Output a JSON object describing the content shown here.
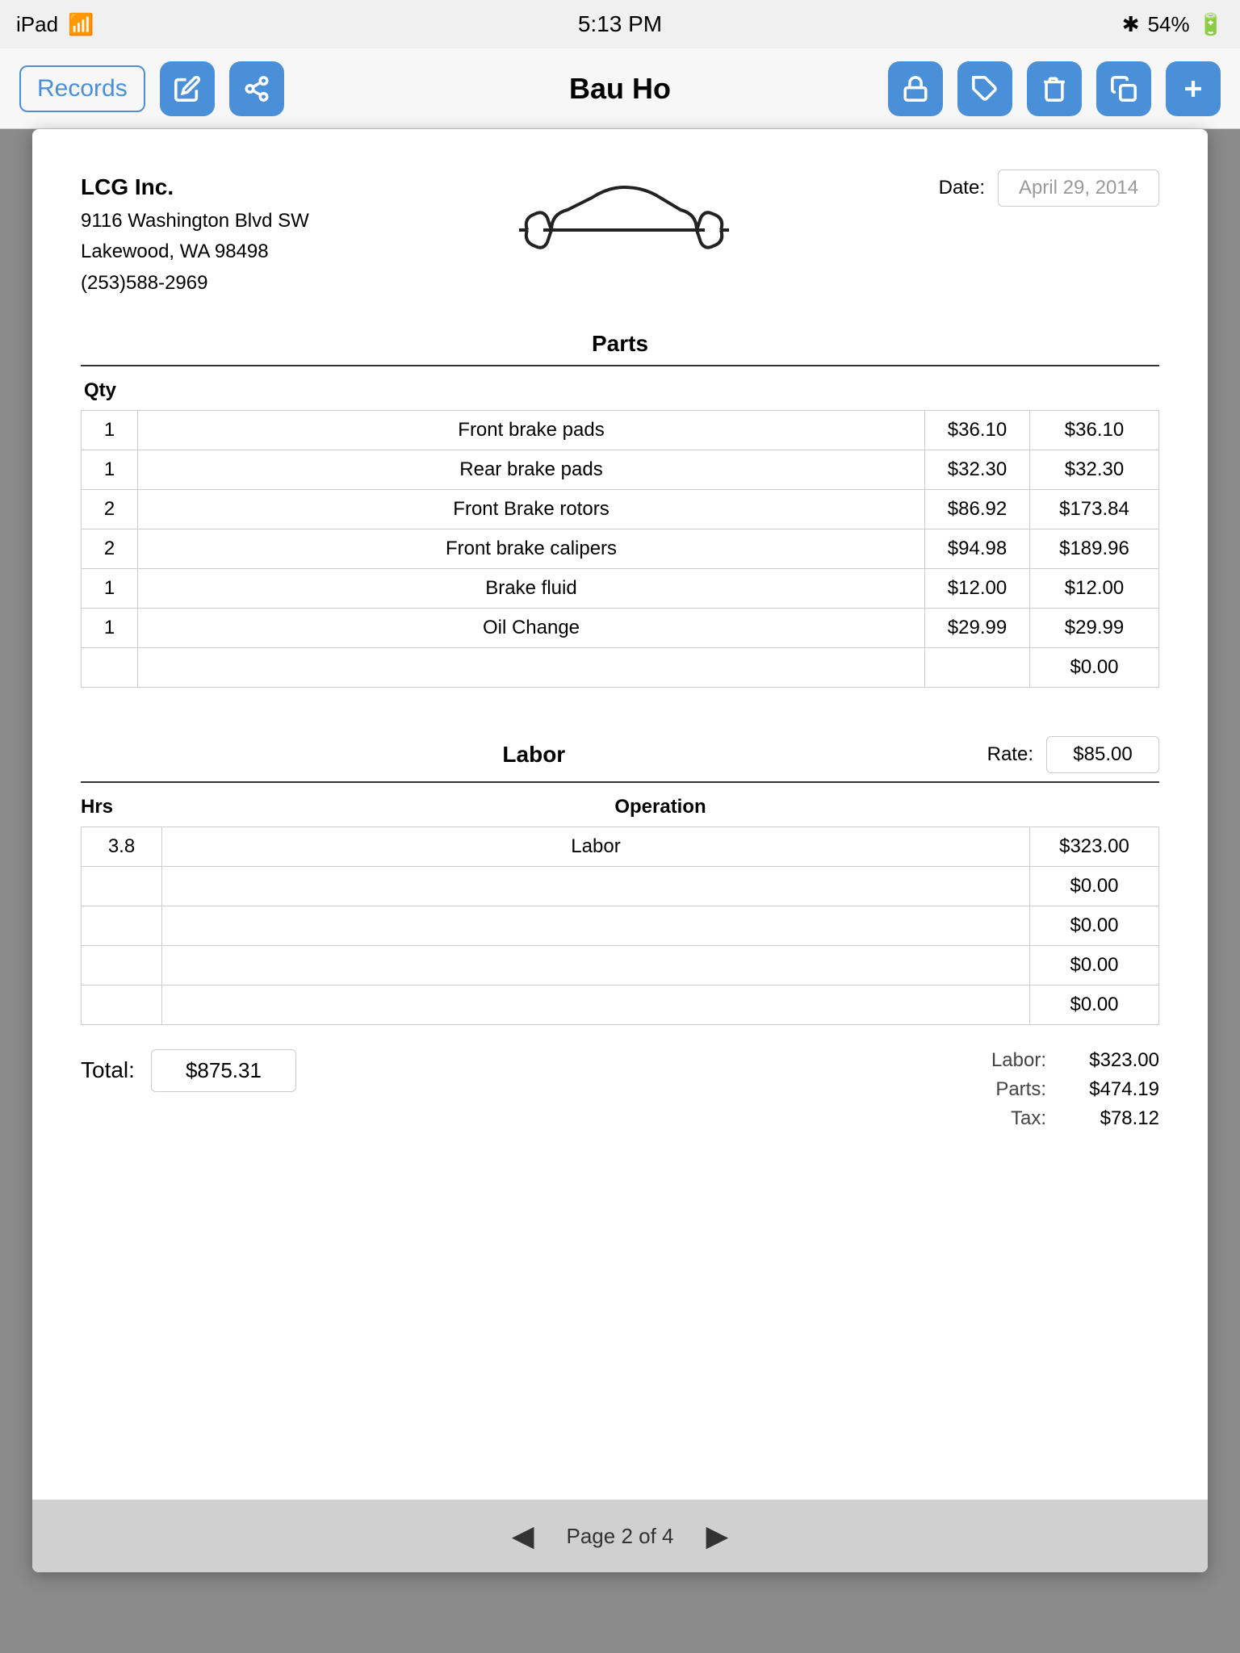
{
  "statusBar": {
    "carrier": "iPad",
    "wifi": true,
    "time": "5:13 PM",
    "bluetooth": true,
    "battery": "54%"
  },
  "navBar": {
    "recordsLabel": "Records",
    "title": "Bau Ho"
  },
  "document": {
    "company": {
      "name": "LCG Inc.",
      "address1": "9116 Washington Blvd SW",
      "address2": "Lakewood, WA  98498",
      "phone": "(253)588-2969"
    },
    "dateLabel": "Date:",
    "dateValue": "April 29, 2014",
    "partsSection": {
      "title": "Parts",
      "qtyHeader": "Qty",
      "rows": [
        {
          "qty": "1",
          "desc": "Front brake pads",
          "price": "$36.10",
          "total": "$36.10"
        },
        {
          "qty": "1",
          "desc": "Rear brake pads",
          "price": "$32.30",
          "total": "$32.30"
        },
        {
          "qty": "2",
          "desc": "Front Brake rotors",
          "price": "$86.92",
          "total": "$173.84"
        },
        {
          "qty": "2",
          "desc": "Front brake calipers",
          "price": "$94.98",
          "total": "$189.96"
        },
        {
          "qty": "1",
          "desc": "Brake fluid",
          "price": "$12.00",
          "total": "$12.00"
        },
        {
          "qty": "1",
          "desc": "Oil Change",
          "price": "$29.99",
          "total": "$29.99"
        },
        {
          "qty": "",
          "desc": "",
          "price": "",
          "total": "$0.00"
        }
      ]
    },
    "laborSection": {
      "title": "Labor",
      "rateLabel": "Rate:",
      "rateValue": "$85.00",
      "hrsHeader": "Hrs",
      "opHeader": "Operation",
      "rows": [
        {
          "hrs": "3.8",
          "op": "Labor",
          "total": "$323.00"
        },
        {
          "hrs": "",
          "op": "",
          "total": "$0.00"
        },
        {
          "hrs": "",
          "op": "",
          "total": "$0.00"
        },
        {
          "hrs": "",
          "op": "",
          "total": "$0.00"
        },
        {
          "hrs": "",
          "op": "",
          "total": "$0.00"
        }
      ]
    },
    "summary": {
      "totalLabel": "Total:",
      "totalValue": "$875.31",
      "laborLabel": "Labor:",
      "laborValue": "$323.00",
      "partsLabel": "Parts:",
      "partsValue": "$474.19",
      "taxLabel": "Tax:",
      "taxValue": "$78.12"
    }
  },
  "pagination": {
    "label": "Page 2 of 4"
  }
}
